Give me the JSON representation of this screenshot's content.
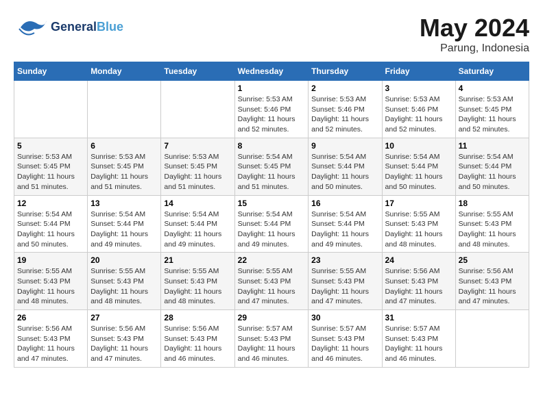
{
  "header": {
    "logo_general": "General",
    "logo_blue": "Blue",
    "title": "May 2024",
    "location": "Parung, Indonesia"
  },
  "days_of_week": [
    "Sunday",
    "Monday",
    "Tuesday",
    "Wednesday",
    "Thursday",
    "Friday",
    "Saturday"
  ],
  "weeks": [
    [
      {
        "day": "",
        "info": ""
      },
      {
        "day": "",
        "info": ""
      },
      {
        "day": "",
        "info": ""
      },
      {
        "day": "1",
        "info": "Sunrise: 5:53 AM\nSunset: 5:46 PM\nDaylight: 11 hours\nand 52 minutes."
      },
      {
        "day": "2",
        "info": "Sunrise: 5:53 AM\nSunset: 5:46 PM\nDaylight: 11 hours\nand 52 minutes."
      },
      {
        "day": "3",
        "info": "Sunrise: 5:53 AM\nSunset: 5:46 PM\nDaylight: 11 hours\nand 52 minutes."
      },
      {
        "day": "4",
        "info": "Sunrise: 5:53 AM\nSunset: 5:45 PM\nDaylight: 11 hours\nand 52 minutes."
      }
    ],
    [
      {
        "day": "5",
        "info": "Sunrise: 5:53 AM\nSunset: 5:45 PM\nDaylight: 11 hours\nand 51 minutes."
      },
      {
        "day": "6",
        "info": "Sunrise: 5:53 AM\nSunset: 5:45 PM\nDaylight: 11 hours\nand 51 minutes."
      },
      {
        "day": "7",
        "info": "Sunrise: 5:53 AM\nSunset: 5:45 PM\nDaylight: 11 hours\nand 51 minutes."
      },
      {
        "day": "8",
        "info": "Sunrise: 5:54 AM\nSunset: 5:45 PM\nDaylight: 11 hours\nand 51 minutes."
      },
      {
        "day": "9",
        "info": "Sunrise: 5:54 AM\nSunset: 5:44 PM\nDaylight: 11 hours\nand 50 minutes."
      },
      {
        "day": "10",
        "info": "Sunrise: 5:54 AM\nSunset: 5:44 PM\nDaylight: 11 hours\nand 50 minutes."
      },
      {
        "day": "11",
        "info": "Sunrise: 5:54 AM\nSunset: 5:44 PM\nDaylight: 11 hours\nand 50 minutes."
      }
    ],
    [
      {
        "day": "12",
        "info": "Sunrise: 5:54 AM\nSunset: 5:44 PM\nDaylight: 11 hours\nand 50 minutes."
      },
      {
        "day": "13",
        "info": "Sunrise: 5:54 AM\nSunset: 5:44 PM\nDaylight: 11 hours\nand 49 minutes."
      },
      {
        "day": "14",
        "info": "Sunrise: 5:54 AM\nSunset: 5:44 PM\nDaylight: 11 hours\nand 49 minutes."
      },
      {
        "day": "15",
        "info": "Sunrise: 5:54 AM\nSunset: 5:44 PM\nDaylight: 11 hours\nand 49 minutes."
      },
      {
        "day": "16",
        "info": "Sunrise: 5:54 AM\nSunset: 5:44 PM\nDaylight: 11 hours\nand 49 minutes."
      },
      {
        "day": "17",
        "info": "Sunrise: 5:55 AM\nSunset: 5:43 PM\nDaylight: 11 hours\nand 48 minutes."
      },
      {
        "day": "18",
        "info": "Sunrise: 5:55 AM\nSunset: 5:43 PM\nDaylight: 11 hours\nand 48 minutes."
      }
    ],
    [
      {
        "day": "19",
        "info": "Sunrise: 5:55 AM\nSunset: 5:43 PM\nDaylight: 11 hours\nand 48 minutes."
      },
      {
        "day": "20",
        "info": "Sunrise: 5:55 AM\nSunset: 5:43 PM\nDaylight: 11 hours\nand 48 minutes."
      },
      {
        "day": "21",
        "info": "Sunrise: 5:55 AM\nSunset: 5:43 PM\nDaylight: 11 hours\nand 48 minutes."
      },
      {
        "day": "22",
        "info": "Sunrise: 5:55 AM\nSunset: 5:43 PM\nDaylight: 11 hours\nand 47 minutes."
      },
      {
        "day": "23",
        "info": "Sunrise: 5:55 AM\nSunset: 5:43 PM\nDaylight: 11 hours\nand 47 minutes."
      },
      {
        "day": "24",
        "info": "Sunrise: 5:56 AM\nSunset: 5:43 PM\nDaylight: 11 hours\nand 47 minutes."
      },
      {
        "day": "25",
        "info": "Sunrise: 5:56 AM\nSunset: 5:43 PM\nDaylight: 11 hours\nand 47 minutes."
      }
    ],
    [
      {
        "day": "26",
        "info": "Sunrise: 5:56 AM\nSunset: 5:43 PM\nDaylight: 11 hours\nand 47 minutes."
      },
      {
        "day": "27",
        "info": "Sunrise: 5:56 AM\nSunset: 5:43 PM\nDaylight: 11 hours\nand 47 minutes."
      },
      {
        "day": "28",
        "info": "Sunrise: 5:56 AM\nSunset: 5:43 PM\nDaylight: 11 hours\nand 46 minutes."
      },
      {
        "day": "29",
        "info": "Sunrise: 5:57 AM\nSunset: 5:43 PM\nDaylight: 11 hours\nand 46 minutes."
      },
      {
        "day": "30",
        "info": "Sunrise: 5:57 AM\nSunset: 5:43 PM\nDaylight: 11 hours\nand 46 minutes."
      },
      {
        "day": "31",
        "info": "Sunrise: 5:57 AM\nSunset: 5:43 PM\nDaylight: 11 hours\nand 46 minutes."
      },
      {
        "day": "",
        "info": ""
      }
    ]
  ]
}
